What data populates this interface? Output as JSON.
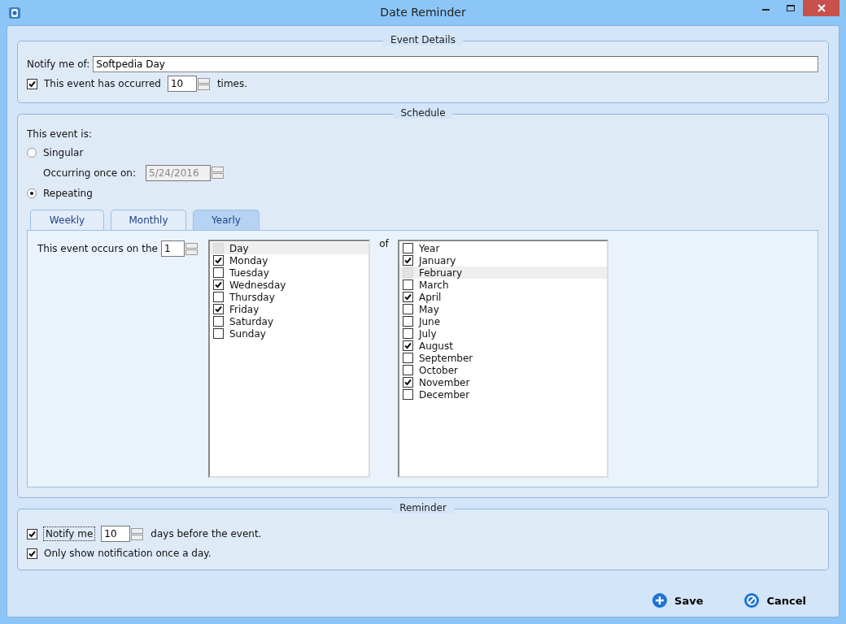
{
  "window": {
    "title": "Date Reminder"
  },
  "event_details": {
    "legend": "Event Details",
    "notify_label": "Notify me of:",
    "notify_value": "Softpedia Day",
    "occurred": {
      "checked": true,
      "label": "This event has occurred",
      "value": "10",
      "suffix": "times."
    }
  },
  "schedule": {
    "legend": "Schedule",
    "intro": "This event is:",
    "options": [
      {
        "label": "Singular",
        "selected": false
      },
      {
        "label": "Repeating",
        "selected": true
      }
    ],
    "once_label": "Occurring once on:",
    "once_value": "5/24/2016",
    "once_disabled": true,
    "tabs": [
      {
        "label": "Weekly",
        "selected": false
      },
      {
        "label": "Monthly",
        "selected": false
      },
      {
        "label": "Yearly",
        "selected": true
      }
    ],
    "occurs_label": "This event occurs on the",
    "occurs_value": "1",
    "of_label": "of",
    "days": [
      {
        "label": "Day",
        "checked": false,
        "highlighted": true
      },
      {
        "label": "Monday",
        "checked": true,
        "highlighted": false
      },
      {
        "label": "Tuesday",
        "checked": false,
        "highlighted": false
      },
      {
        "label": "Wednesday",
        "checked": true,
        "highlighted": false
      },
      {
        "label": "Thursday",
        "checked": false,
        "highlighted": false
      },
      {
        "label": "Friday",
        "checked": true,
        "highlighted": false
      },
      {
        "label": "Saturday",
        "checked": false,
        "highlighted": false
      },
      {
        "label": "Sunday",
        "checked": false,
        "highlighted": false
      }
    ],
    "months": [
      {
        "label": "Year",
        "checked": false,
        "highlighted": false
      },
      {
        "label": "January",
        "checked": true,
        "highlighted": false
      },
      {
        "label": "February",
        "checked": false,
        "highlighted": true
      },
      {
        "label": "March",
        "checked": false,
        "highlighted": false
      },
      {
        "label": "April",
        "checked": true,
        "highlighted": false
      },
      {
        "label": "May",
        "checked": false,
        "highlighted": false
      },
      {
        "label": "June",
        "checked": false,
        "highlighted": false
      },
      {
        "label": "July",
        "checked": false,
        "highlighted": false
      },
      {
        "label": "August",
        "checked": true,
        "highlighted": false
      },
      {
        "label": "September",
        "checked": false,
        "highlighted": false
      },
      {
        "label": "October",
        "checked": false,
        "highlighted": false
      },
      {
        "label": "November",
        "checked": true,
        "highlighted": false
      },
      {
        "label": "December",
        "checked": false,
        "highlighted": false
      }
    ]
  },
  "reminder": {
    "legend": "Reminder",
    "notify": {
      "checked": true,
      "label": "Notify me",
      "value": "10",
      "suffix": "days before the event.",
      "focused": true
    },
    "once": {
      "checked": true,
      "label": "Only show notification once a day."
    }
  },
  "buttons": [
    {
      "label": "Save",
      "kind": "save"
    },
    {
      "label": "Cancel",
      "kind": "cancel"
    }
  ]
}
